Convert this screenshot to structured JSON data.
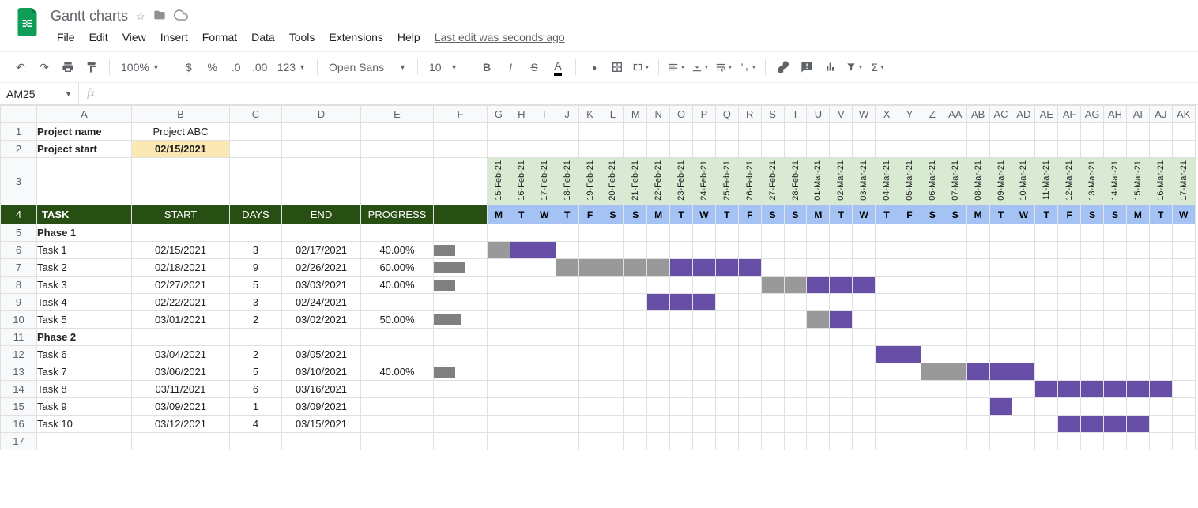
{
  "doc_title": "Gantt charts",
  "menus": [
    "File",
    "Edit",
    "View",
    "Insert",
    "Format",
    "Data",
    "Tools",
    "Extensions",
    "Help"
  ],
  "last_edit": "Last edit was seconds ago",
  "toolbar": {
    "zoom": "100%",
    "font": "Open Sans",
    "fontsize": "10"
  },
  "name_box": "AM25",
  "cols_wide": [
    "A",
    "B",
    "C",
    "D",
    "E",
    "F"
  ],
  "cols_narrow": [
    "G",
    "H",
    "I",
    "J",
    "K",
    "L",
    "M",
    "N",
    "O",
    "P",
    "Q",
    "R",
    "S",
    "T",
    "U",
    "V",
    "W",
    "X",
    "Y",
    "Z",
    "AA",
    "AB",
    "AC",
    "AD",
    "AE",
    "AF",
    "AG",
    "AH",
    "AI",
    "AJ",
    "AK"
  ],
  "project": {
    "name_label": "Project name",
    "name_value": "Project ABC",
    "start_label": "Project start",
    "start_value": "02/15/2021"
  },
  "dates": [
    "15-Feb-21",
    "16-Feb-21",
    "17-Feb-21",
    "18-Feb-21",
    "19-Feb-21",
    "20-Feb-21",
    "21-Feb-21",
    "22-Feb-21",
    "23-Feb-21",
    "24-Feb-21",
    "25-Feb-21",
    "26-Feb-21",
    "27-Feb-21",
    "28-Feb-21",
    "01-Mar-21",
    "02-Mar-21",
    "03-Mar-21",
    "04-Mar-21",
    "05-Mar-21",
    "06-Mar-21",
    "07-Mar-21",
    "08-Mar-21",
    "09-Mar-21",
    "10-Mar-21",
    "11-Mar-21",
    "12-Mar-21",
    "13-Mar-21",
    "14-Mar-21",
    "15-Mar-21",
    "16-Mar-21",
    "17-Mar-21"
  ],
  "dow": [
    "M",
    "T",
    "W",
    "T",
    "F",
    "S",
    "S",
    "M",
    "T",
    "W",
    "T",
    "F",
    "S",
    "S",
    "M",
    "T",
    "W",
    "T",
    "F",
    "S",
    "S",
    "M",
    "T",
    "W",
    "T",
    "F",
    "S",
    "S",
    "M",
    "T",
    "W"
  ],
  "captions": {
    "task": "TASK",
    "start": "START",
    "days": "DAYS",
    "end": "END",
    "progress": "PROGRESS"
  },
  "phases": {
    "p1": "Phase 1",
    "p2": "Phase 2"
  },
  "rows": [
    {
      "rn": 5,
      "task": "Phase 1",
      "bold": true
    },
    {
      "rn": 6,
      "task": "Task 1",
      "start": "02/15/2021",
      "days": "3",
      "end": "02/17/2021",
      "prog": "40.00%",
      "spark": 40,
      "bar": {
        "off": 0,
        "gray": 1,
        "purp": 2
      }
    },
    {
      "rn": 7,
      "task": "Task 2",
      "start": "02/18/2021",
      "days": "9",
      "end": "02/26/2021",
      "prog": "60.00%",
      "spark": 60,
      "bar": {
        "off": 3,
        "gray": 5,
        "purp": 4
      }
    },
    {
      "rn": 8,
      "task": "Task 3",
      "start": "02/27/2021",
      "days": "5",
      "end": "03/03/2021",
      "prog": "40.00%",
      "spark": 40,
      "bar": {
        "off": 12,
        "gray": 2,
        "purp": 3
      }
    },
    {
      "rn": 9,
      "task": "Task 4",
      "start": "02/22/2021",
      "days": "3",
      "end": "02/24/2021",
      "prog": "",
      "bar": {
        "off": 7,
        "gray": 0,
        "purp": 3
      }
    },
    {
      "rn": 10,
      "task": "Task 5",
      "start": "03/01/2021",
      "days": "2",
      "end": "03/02/2021",
      "prog": "50.00%",
      "spark": 50,
      "bar": {
        "off": 14,
        "gray": 1,
        "purp": 1
      }
    },
    {
      "rn": 11,
      "task": "Phase 2",
      "bold": true
    },
    {
      "rn": 12,
      "task": "Task 6",
      "start": "03/04/2021",
      "days": "2",
      "end": "03/05/2021",
      "prog": "",
      "bar": {
        "off": 17,
        "gray": 0,
        "purp": 2
      }
    },
    {
      "rn": 13,
      "task": "Task 7",
      "start": "03/06/2021",
      "days": "5",
      "end": "03/10/2021",
      "prog": "40.00%",
      "spark": 40,
      "bar": {
        "off": 19,
        "gray": 2,
        "purp": 3
      }
    },
    {
      "rn": 14,
      "task": "Task 8",
      "start": "03/11/2021",
      "days": "6",
      "end": "03/16/2021",
      "prog": "",
      "bar": {
        "off": 24,
        "gray": 0,
        "purp": 6
      }
    },
    {
      "rn": 15,
      "task": "Task 9",
      "start": "03/09/2021",
      "days": "1",
      "end": "03/09/2021",
      "prog": "",
      "bar": {
        "off": 22,
        "gray": 0,
        "purp": 1
      }
    },
    {
      "rn": 16,
      "task": "Task 10",
      "start": "03/12/2021",
      "days": "4",
      "end": "03/15/2021",
      "prog": "",
      "bar": {
        "off": 25,
        "gray": 0,
        "purp": 4
      }
    },
    {
      "rn": 17,
      "task": ""
    }
  ]
}
